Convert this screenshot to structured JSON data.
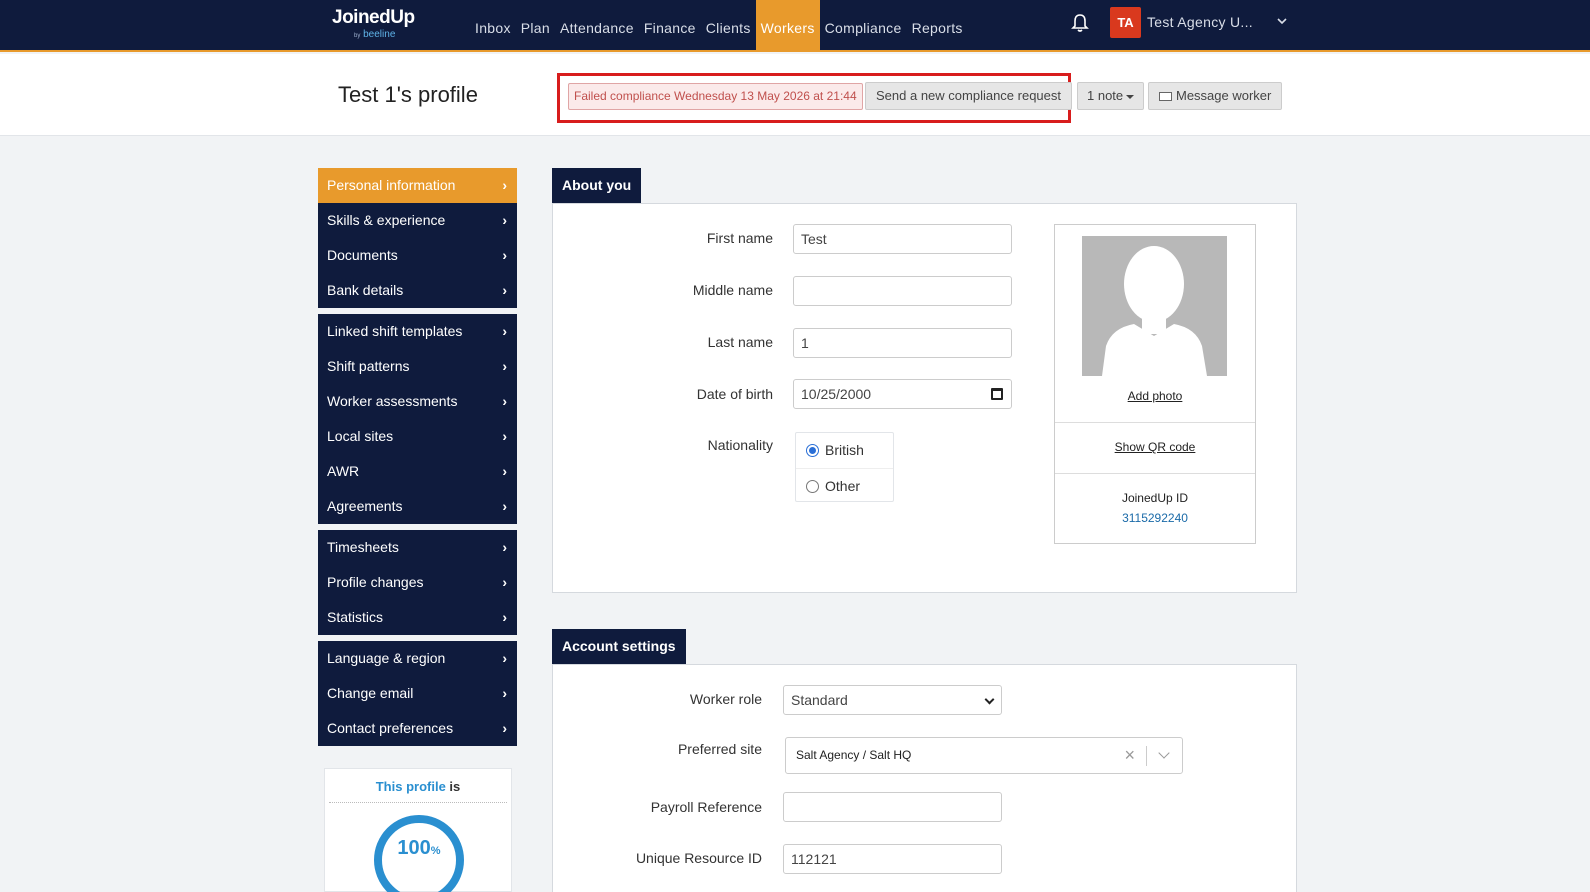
{
  "topbar": {
    "logo_main": "JoinedUp",
    "logo_by": "by",
    "logo_sub": "beeline",
    "nav": [
      "Inbox",
      "Plan",
      "Attendance",
      "Finance",
      "Clients",
      "Workers",
      "Compliance",
      "Reports"
    ],
    "active_nav": "Workers",
    "avatar_initials": "TA",
    "agency_name": "Test Agency U..."
  },
  "header": {
    "title": "Test 1's profile",
    "failed_badge": "Failed compliance Wednesday 13 May 2026 at 21:44",
    "send_request": "Send a new compliance request",
    "notes": "1 note",
    "message_worker": "Message worker"
  },
  "sidebar": {
    "groups": [
      [
        "Personal information",
        "Skills & experience",
        "Documents",
        "Bank details"
      ],
      [
        "Linked shift templates",
        "Shift patterns",
        "Worker assessments",
        "Local sites",
        "AWR",
        "Agreements"
      ],
      [
        "Timesheets",
        "Profile changes",
        "Statistics"
      ],
      [
        "Language & region",
        "Change email",
        "Contact preferences"
      ]
    ],
    "active": "Personal information"
  },
  "profile_progress": {
    "title_link": "This profile",
    "title_rest": "is",
    "percent": "100",
    "percent_sign": "%"
  },
  "about": {
    "tab": "About you",
    "first_name_label": "First name",
    "first_name": "Test",
    "middle_name_label": "Middle name",
    "middle_name": "",
    "last_name_label": "Last name",
    "last_name": "1",
    "dob_label": "Date of birth",
    "dob": "10/25/2000",
    "nationality_label": "Nationality",
    "nationality_options": [
      "British",
      "Other"
    ],
    "nationality_selected": "British",
    "add_photo": "Add photo",
    "show_qr": "Show QR code",
    "joinedup_id_label": "JoinedUp ID",
    "joinedup_id": "3115292240"
  },
  "account": {
    "tab": "Account settings",
    "worker_role_label": "Worker role",
    "worker_role": "Standard",
    "preferred_site_label": "Preferred site",
    "preferred_site": "Salt Agency / Salt HQ",
    "payroll_label": "Payroll Reference",
    "payroll": "",
    "uri_label": "Unique Resource ID",
    "uri": "112121"
  },
  "colors": {
    "navy": "#0f1b3d",
    "accent": "#e89a2c",
    "danger": "#d81d1d",
    "link": "#2a8fd0"
  }
}
